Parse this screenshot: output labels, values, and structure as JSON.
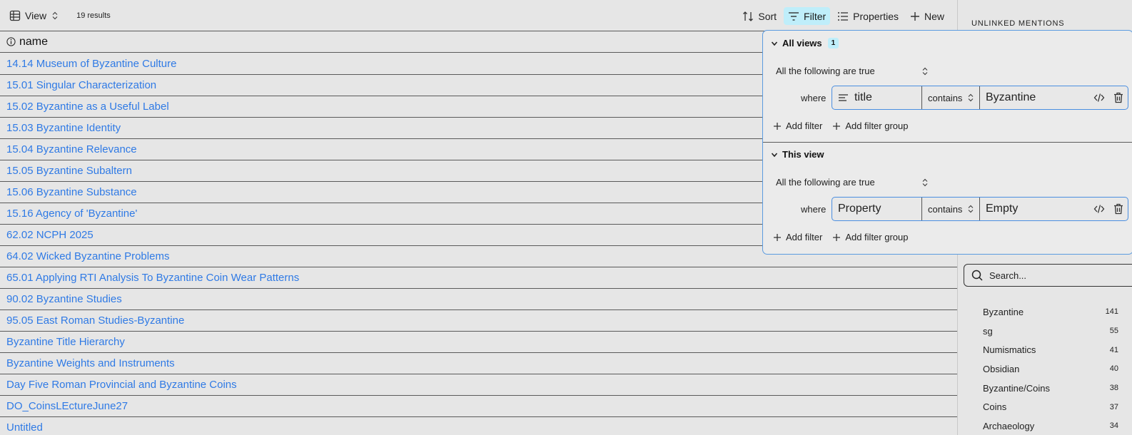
{
  "toolbar": {
    "view_label": "View",
    "results": "19 results",
    "sort_label": "Sort",
    "filter_label": "Filter",
    "properties_label": "Properties",
    "new_label": "New"
  },
  "table": {
    "column_header": "name",
    "rows": [
      "14.14 Museum of Byzantine Culture",
      "15.01 Singular Characterization",
      "15.02 Byzantine as a Useful Label",
      "15.03 Byzantine Identity",
      "15.04 Byzantine Relevance",
      "15.05 Byzantine Subaltern",
      "15.06 Byzantine Substance",
      "15.16 Agency of 'Byzantine'",
      "62.02 NCPH 2025",
      "64.02 Wicked Byzantine Problems",
      "65.01 Applying RTI Analysis To Byzantine Coin Wear Patterns",
      "90.02 Byzantine Studies",
      "95.05 East Roman Studies-Byzantine",
      "Byzantine Title Hierarchy",
      "Byzantine Weights and Instruments",
      "Day Five Roman Provincial and Byzantine Coins",
      "DO_CoinsLEctureJune27",
      "Untitled"
    ]
  },
  "filter": {
    "all_views": {
      "title": "All views",
      "badge": "1",
      "condition": "All the following are true",
      "where": "where",
      "property": "title",
      "operator": "contains",
      "value": "Byzantine",
      "add_filter": "Add filter",
      "add_group": "Add filter group"
    },
    "this_view": {
      "title": "This view",
      "condition": "All the following are true",
      "where": "where",
      "property": "Property",
      "operator": "contains",
      "value": "Empty",
      "add_filter": "Add filter",
      "add_group": "Add filter group"
    }
  },
  "sidebar": {
    "title": "UNLINKED MENTIONS",
    "search_placeholder": "Search...",
    "tags": [
      {
        "name": "Byzantine",
        "count": "141"
      },
      {
        "name": "sg",
        "count": "55"
      },
      {
        "name": "Numismatics",
        "count": "41"
      },
      {
        "name": "Obsidian",
        "count": "40"
      },
      {
        "name": "Byzantine/Coins",
        "count": "38"
      },
      {
        "name": "Coins",
        "count": "37"
      },
      {
        "name": "Archaeology",
        "count": "34"
      }
    ]
  }
}
